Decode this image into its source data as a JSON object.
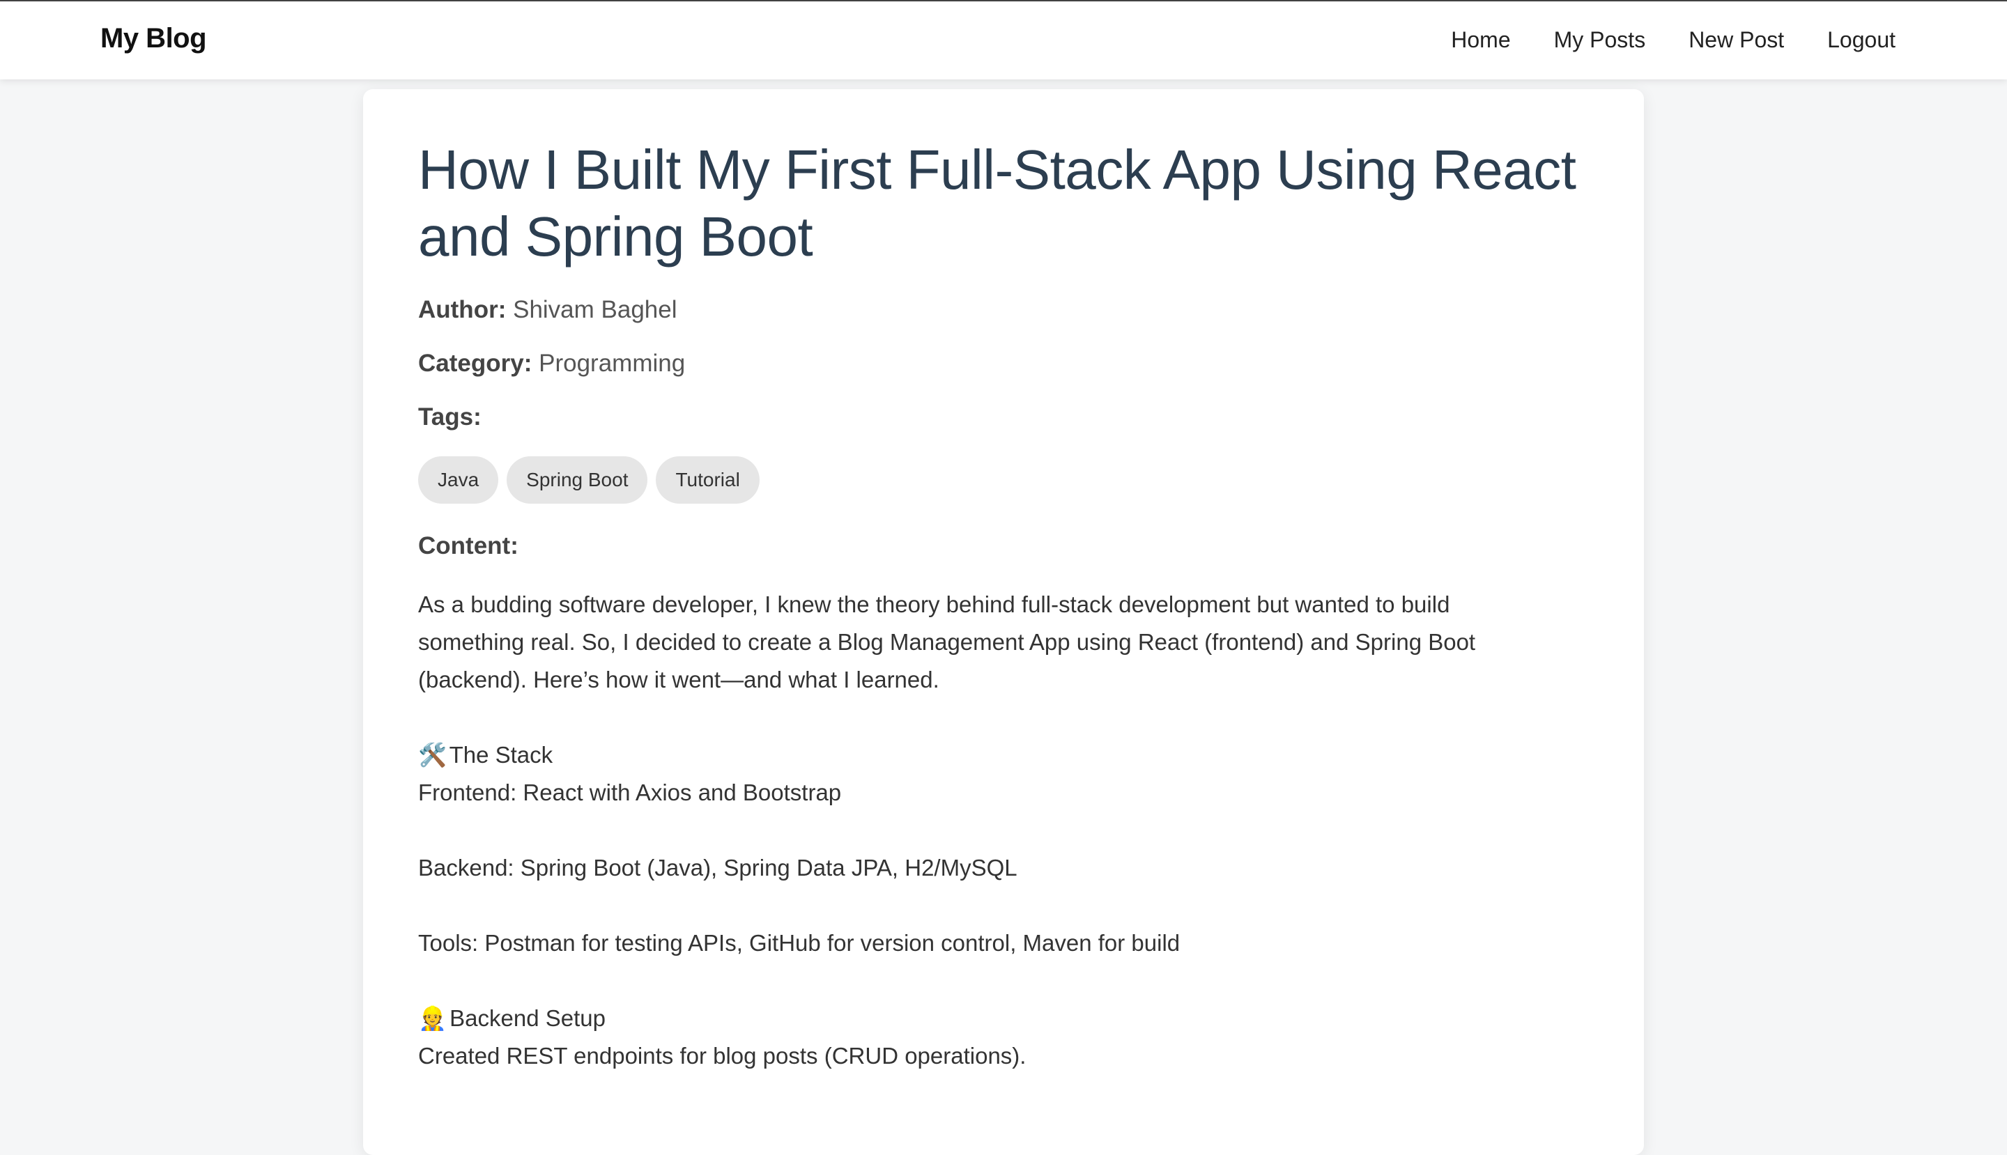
{
  "navbar": {
    "brand": "My Blog",
    "links": [
      "Home",
      "My Posts",
      "New Post",
      "Logout"
    ]
  },
  "post": {
    "title": "How I Built My First Full-Stack App Using React and Spring Boot",
    "author_label": "Author:",
    "author": "Shivam Baghel",
    "category_label": "Category:",
    "category": "Programming",
    "tags_label": "Tags:",
    "tags": [
      "Java",
      "Spring Boot",
      "Tutorial"
    ],
    "content_label": "Content:",
    "intro": "As a budding software developer, I knew the theory behind full-stack development but wanted to build something real. So, I decided to create a Blog Management App using React (frontend) and Spring Boot (backend). Here’s how it went—and what I learned.",
    "stack_icon": "🛠️",
    "stack_heading": "The Stack",
    "stack_frontend": "Frontend: React with Axios and Bootstrap",
    "stack_backend": "Backend: Spring Boot (Java), Spring Data JPA, H2/MySQL",
    "stack_tools": "Tools: Postman for testing APIs, GitHub for version control, Maven for build",
    "backend_icon": "👷",
    "backend_heading": "Backend Setup",
    "backend_line1": "Created REST endpoints for blog posts (CRUD operations)."
  }
}
